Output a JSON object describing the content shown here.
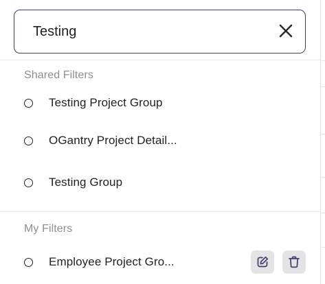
{
  "search": {
    "value": "Testing",
    "clear_icon": "close-icon"
  },
  "shared_filters": {
    "heading": "Shared Filters",
    "items": [
      {
        "label": "Testing Project Group"
      },
      {
        "label": "OGantry Project Detail..."
      },
      {
        "label": "Testing Group"
      }
    ]
  },
  "my_filters": {
    "heading": "My Filters",
    "items": [
      {
        "label": "Employee Project Gro...",
        "edit_icon": "edit-icon",
        "delete_icon": "trash-icon"
      }
    ]
  },
  "colors": {
    "border_accent": "#3f3d6b",
    "text": "#1f1f24",
    "muted": "#8d8d96",
    "action_bg": "#e4e4e7"
  }
}
